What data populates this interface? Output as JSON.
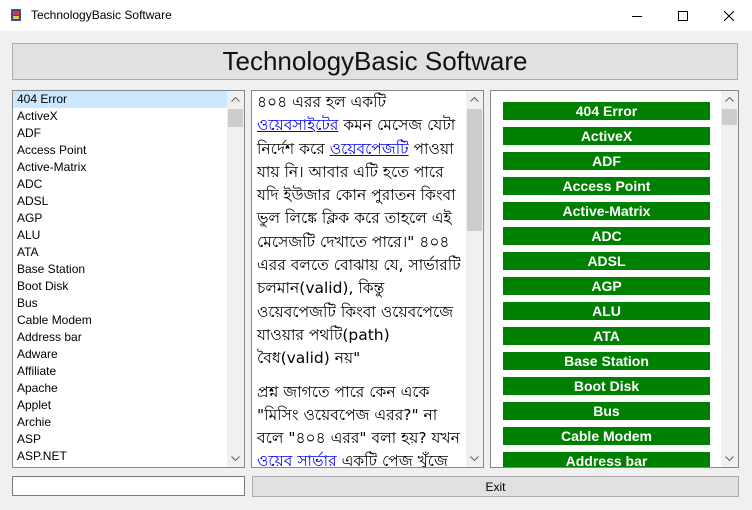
{
  "window": {
    "title": "TechnologyBasic Software"
  },
  "header": {
    "title": "TechnologyBasic Software"
  },
  "left_list": {
    "selected_index": 0,
    "items": [
      "404 Error",
      "ActiveX",
      "ADF",
      "Access Point",
      "Active-Matrix",
      "ADC",
      "ADSL",
      "AGP",
      "ALU",
      "ATA",
      "Base Station",
      "Boot Disk",
      "Bus",
      "Cable Modem",
      "Address bar",
      "Adware",
      "Affiliate",
      "Apache",
      "Applet",
      "Archie",
      "ASP",
      "ASP.NET"
    ]
  },
  "article": {
    "p1": {
      "t1": "৪০৪ এরর হল একটি ",
      "link1": "ওয়েবসাইটের",
      "t2": " কমন মেসেজ যেটা নির্দেশ করে ",
      "link2": "ওয়েবপেজটি",
      "t3": " পাওয়া যায় নি। আবার এটি হতে পারে যদি ইউজার কোন পুরাতন কিংবা ভুল লিঙ্কে ক্লিক করে তাহলে এই মেসেজটি দেখাতে পারে।\" ৪০৪ এরর বলতে বোঝায় যে, সার্ভারটি চলমান(valid), কিন্তু ওয়েবপেজটি কিংবা ওয়েবপেজে যাওয়ার পথটি(path) বৈধ(valid) নয়\""
    },
    "p2": {
      "t1": "প্রশ্ন জাগতে পারে কেন একে \"মিসিং ওয়েবপেজ এরর?\" না বলে \"৪০৪ এরর\" বলা হয়? যখন ",
      "link1": "ওয়েব সার্ভার",
      "t2": " একটি পেজ খুঁজে"
    }
  },
  "right_buttons": [
    "404 Error",
    "ActiveX",
    "ADF",
    "Access Point",
    "Active-Matrix",
    "ADC",
    "ADSL",
    "AGP",
    "ALU",
    "ATA",
    "Base Station",
    "Boot Disk",
    "Bus",
    "Cable Modem",
    "Address bar"
  ],
  "search": {
    "value": ""
  },
  "exit": {
    "label": "Exit"
  },
  "colors": {
    "button_green": "#008000",
    "selection": "#cce8ff",
    "link": "#0000ee"
  }
}
